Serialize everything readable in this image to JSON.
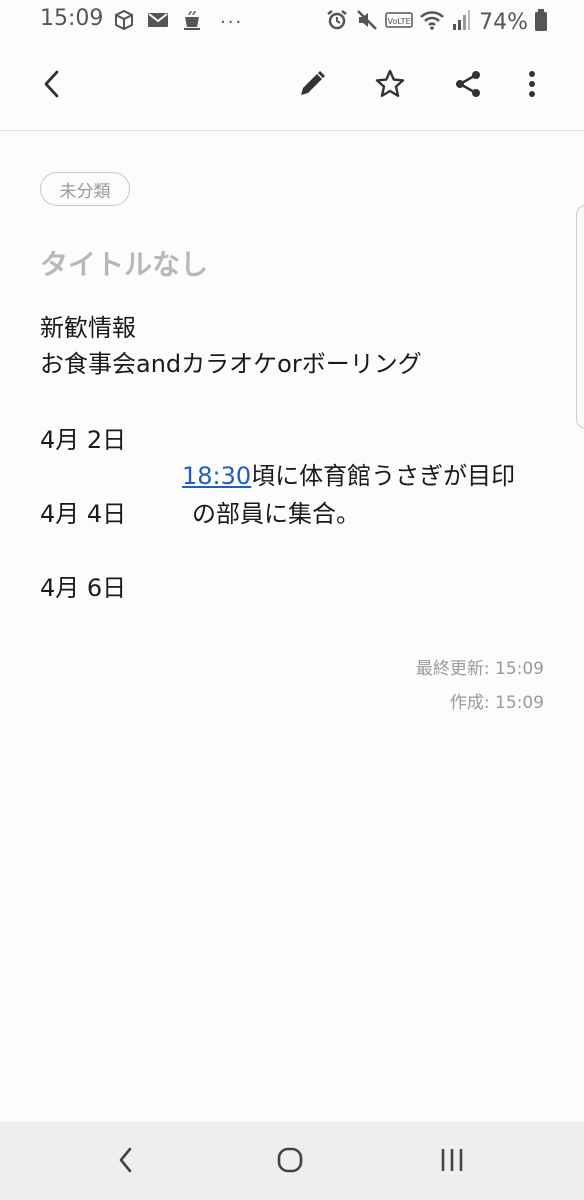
{
  "status_bar": {
    "time": "15:09",
    "more_indicator": "···",
    "battery_text": "74%",
    "left_icons": [
      "box-icon",
      "mail-icon",
      "cup-icon"
    ],
    "right_icons": [
      "alarm-icon",
      "mute-icon",
      "volte-icon",
      "wifi-icon",
      "signal-icon",
      "battery-icon"
    ]
  },
  "toolbar": {
    "back_icon": "chevron-left-icon",
    "edit_icon": "pencil-icon",
    "favorite_icon": "star-icon",
    "share_icon": "share-icon",
    "more_icon": "more-vertical-icon"
  },
  "note": {
    "category": "未分類",
    "title_placeholder": "タイトルなし",
    "lines": {
      "l1": "新歓情報",
      "l2": "お食事会andカラオケorボーリング",
      "l3": "4月 2日",
      "l4_time": "18:30",
      "l4_rest": "頃に体育館うさぎが目印",
      "l5_date": "4月 4日",
      "l5_rest": "の部員に集合。",
      "l6": "4月 6日"
    },
    "last_updated": "最終更新: 15:09",
    "created": "作成: 15:09"
  },
  "nav_bar": {
    "back_icon": "nav-back-icon",
    "home_icon": "nav-home-icon",
    "recents_icon": "nav-recents-icon"
  },
  "colors": {
    "link": "#1f5fbf",
    "text": "#1a1a1a",
    "placeholder": "#b8b8b8",
    "meta": "#9a9a9a"
  }
}
